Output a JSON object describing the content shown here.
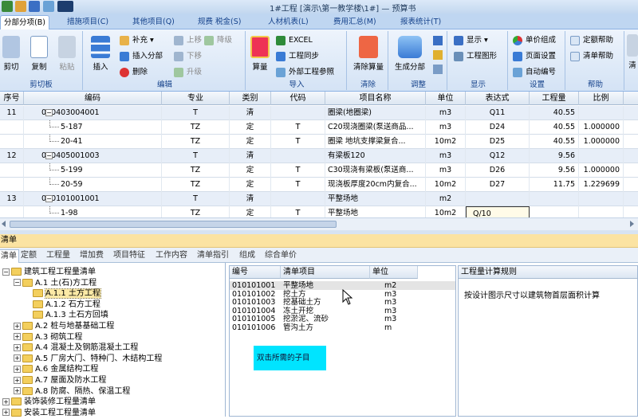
{
  "title": "1#工程 [演示\\第一教学楼\\1#] — 预算书",
  "ribbon_tabs": [
    "分部分项(B)",
    "措施项目(C)",
    "其他项目(Q)",
    "规费 税金(S)",
    "人材机表(L)",
    "费用汇总(M)",
    "报表统计(T)"
  ],
  "ribbon": {
    "clipboard": {
      "cut": "剪切",
      "copy": "复制",
      "paste": "粘贴",
      "group": "剪切板"
    },
    "edit": {
      "insert": "插入",
      "supplement": "补充 ▾",
      "insert_section": "插入分部",
      "delete": "删除",
      "up_level": "上移",
      "down_level": "下移",
      "upgrade": "升级",
      "downgrade": "降级",
      "group": "编辑"
    },
    "import": {
      "calc": "算量",
      "excel": "EXCEL",
      "sync": "工程同步",
      "external": "外部工程参照",
      "group": "导入"
    },
    "clear": {
      "clear_calc": "清除算量",
      "group": "清除"
    },
    "adjust": {
      "gen_section": "生成分部",
      "group": "调整"
    },
    "display": {
      "show": "显示 ▾",
      "graphic": "工程图形",
      "group": "显示"
    },
    "settings": {
      "unit_price": "单价组成",
      "page": "页面设置",
      "auto_num": "自动编号",
      "group": "设置"
    },
    "help": {
      "quota_help": "定额帮助",
      "list_help": "清单帮助",
      "group": "帮助"
    },
    "extra": {
      "label": "清"
    }
  },
  "grid": {
    "headers": [
      "序号",
      "编码",
      "专业",
      "类别",
      "代码",
      "项目名称",
      "单位",
      "表达式",
      "工程量",
      "比例"
    ],
    "rows": [
      {
        "seq": "11",
        "code": "010403004001",
        "major": "T",
        "cat": "清",
        "dcode": "",
        "name": "圈梁(地圈梁)",
        "unit": "m3",
        "expr": "Q11",
        "qty": "40.55",
        "ratio": "",
        "type": "q"
      },
      {
        "seq": "",
        "code": "5-187",
        "major": "TZ",
        "cat": "定",
        "dcode": "T",
        "name": "C20现浇圈梁(泵送商品...",
        "unit": "m3",
        "expr": "D24",
        "qty": "40.55",
        "ratio": "1.000000",
        "type": "d"
      },
      {
        "seq": "",
        "code": "20-41",
        "major": "TZ",
        "cat": "定",
        "dcode": "T",
        "name": "圈梁 地坑支撑梁复合...",
        "unit": "10m2",
        "expr": "D25",
        "qty": "40.55",
        "ratio": "1.000000",
        "type": "d"
      },
      {
        "seq": "12",
        "code": "010405001003",
        "major": "T",
        "cat": "清",
        "dcode": "",
        "name": "有梁板120",
        "unit": "m3",
        "expr": "Q12",
        "qty": "9.56",
        "ratio": "",
        "type": "q"
      },
      {
        "seq": "",
        "code": "5-199",
        "major": "TZ",
        "cat": "定",
        "dcode": "T",
        "name": "C30现浇有梁板(泵送商...",
        "unit": "m3",
        "expr": "D26",
        "qty": "9.56",
        "ratio": "1.000000",
        "type": "d"
      },
      {
        "seq": "",
        "code": "20-59",
        "major": "TZ",
        "cat": "定",
        "dcode": "T",
        "name": "现浇板厚度20cm内复合...",
        "unit": "10m2",
        "expr": "D27",
        "qty": "11.75",
        "ratio": "1.229699",
        "type": "d"
      },
      {
        "seq": "13",
        "code": "010101001001",
        "major": "T",
        "cat": "清",
        "dcode": "",
        "name": "平整场地",
        "unit": "m2",
        "expr": "",
        "qty": "",
        "ratio": "",
        "type": "q"
      },
      {
        "seq": "",
        "code": "1-98",
        "major": "TZ",
        "cat": "定",
        "dcode": "T",
        "name": "平整场地",
        "unit": "10m2",
        "expr": "Q/10",
        "qty": "",
        "ratio": "",
        "type": "d"
      }
    ]
  },
  "panel_title": "清单",
  "sub_tabs": [
    "清单",
    "定额",
    "工程量",
    "增加费",
    "项目特征",
    "工作内容",
    "清单指引",
    "组成",
    "综合单价"
  ],
  "tree": [
    {
      "label": "建筑工程工程量清单",
      "level": 0,
      "pm": "−"
    },
    {
      "label": "A.1 土(石)方工程",
      "level": 1,
      "pm": "−"
    },
    {
      "label": "A.1.1 土方工程",
      "level": 2,
      "pm": "",
      "selected": true
    },
    {
      "label": "A.1.2 石方工程",
      "level": 2,
      "pm": ""
    },
    {
      "label": "A.1.3 土石方回填",
      "level": 2,
      "pm": ""
    },
    {
      "label": "A.2 桩与地基基础工程",
      "level": 1,
      "pm": "+"
    },
    {
      "label": "A.3 砌筑工程",
      "level": 1,
      "pm": "+"
    },
    {
      "label": "A.4 混凝土及钢筋混凝土工程",
      "level": 1,
      "pm": "+"
    },
    {
      "label": "A.5 厂房大门、特种门、木结构工程",
      "level": 1,
      "pm": "+"
    },
    {
      "label": "A.6 金属结构工程",
      "level": 1,
      "pm": "+"
    },
    {
      "label": "A.7 屋面及防水工程",
      "level": 1,
      "pm": "+"
    },
    {
      "label": "A.8 防腐、隔热、保温工程",
      "level": 1,
      "pm": "+"
    },
    {
      "label": "装饰装修工程量清单",
      "level": 0,
      "pm": "+"
    },
    {
      "label": "安装工程工程量清单",
      "level": 0,
      "pm": "+"
    }
  ],
  "list": {
    "headers": [
      "编号",
      "清单项目",
      "单位"
    ],
    "rows": [
      {
        "code": "010101001",
        "name": "平整场地",
        "unit": "m2"
      },
      {
        "code": "010101002",
        "name": "挖土方",
        "unit": "m3"
      },
      {
        "code": "010101003",
        "name": "挖基础土方",
        "unit": "m3"
      },
      {
        "code": "010101004",
        "name": "冻土开挖",
        "unit": "m3"
      },
      {
        "code": "010101005",
        "name": "挖淤泥、流砂",
        "unit": "m3"
      },
      {
        "code": "010101006",
        "name": "管沟土方",
        "unit": "m"
      }
    ]
  },
  "tooltip": "双击所需的子目",
  "rule_pane": {
    "title": "工程量计算规则",
    "text": "按设计图示尺寸以建筑物首层面积计算"
  },
  "colors": {
    "accent": "#15428b",
    "tooltip": "#00e4ff",
    "panel_header": "#fbe3a2",
    "list_row": "#e7eef8"
  }
}
